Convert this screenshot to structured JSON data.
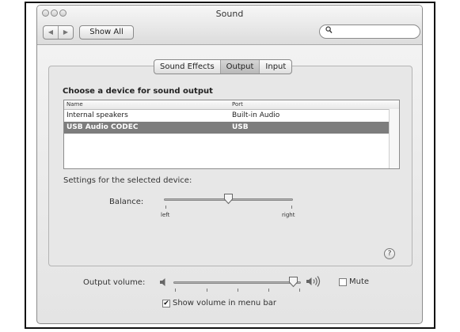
{
  "window": {
    "title": "Sound"
  },
  "toolbar": {
    "back_glyph": "◀",
    "forward_glyph": "▶",
    "show_all_label": "Show All",
    "search_placeholder": "",
    "search_icon": "magnifier-icon"
  },
  "tabs": [
    {
      "label": "Sound Effects",
      "active": false
    },
    {
      "label": "Output",
      "active": true
    },
    {
      "label": "Input",
      "active": false
    }
  ],
  "output": {
    "heading": "Choose a device for sound output",
    "columns": [
      "Name",
      "Port"
    ],
    "devices": [
      {
        "name": "Internal speakers",
        "port": "Built-in Audio",
        "selected": false
      },
      {
        "name": "USB Audio CODEC",
        "port": "USB",
        "selected": true
      }
    ],
    "settings_label": "Settings for the selected device:",
    "balance_label": "Balance:",
    "balance_left": "left",
    "balance_right": "right",
    "balance_value": 0.5,
    "help": "?"
  },
  "volume": {
    "label": "Output volume:",
    "level": 0.95,
    "mute_label": "Mute",
    "mute_checked": false,
    "menu_bar_label": "Show volume in menu bar",
    "menu_bar_checked": true,
    "check_glyph": "✔"
  },
  "colors": {
    "selection": "#7d7d7d",
    "window_bg": "#e7e7e7"
  }
}
